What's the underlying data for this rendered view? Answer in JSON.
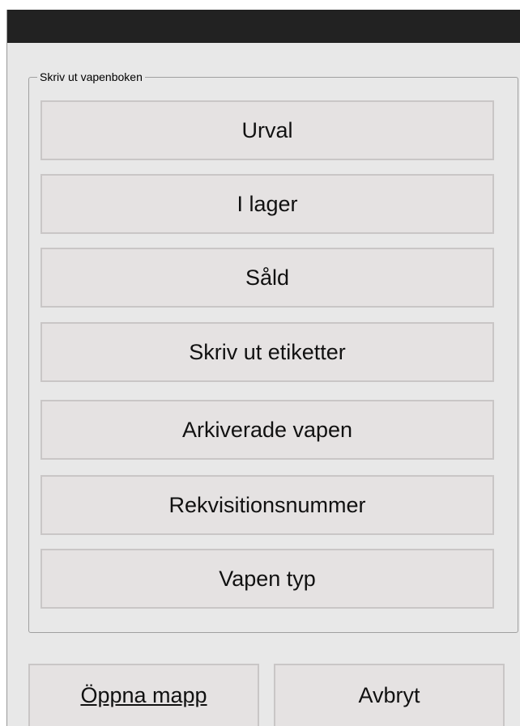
{
  "group": {
    "legend": "Skriv ut vapenboken",
    "buttons": [
      {
        "label": "Urval"
      },
      {
        "label": "I lager"
      },
      {
        "label": "Såld"
      },
      {
        "label": "Skriv ut etiketter"
      },
      {
        "label": "Arkiverade vapen"
      },
      {
        "label": "Rekvisitionsnummer"
      },
      {
        "label": "Vapen typ"
      }
    ]
  },
  "footer": {
    "open_folder_label": "Öppna mapp",
    "cancel_label": "Avbryt"
  }
}
